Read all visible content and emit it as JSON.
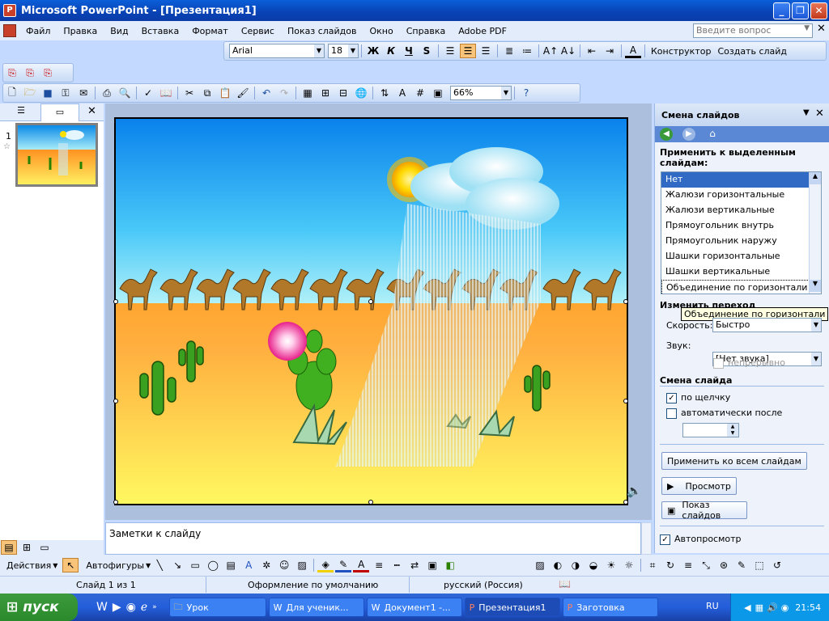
{
  "app": {
    "title": "Microsoft PowerPoint - [Презентация1]"
  },
  "menu": {
    "items": [
      "Файл",
      "Правка",
      "Вид",
      "Вставка",
      "Формат",
      "Сервис",
      "Показ слайдов",
      "Окно",
      "Справка",
      "Adobe PDF"
    ],
    "help_placeholder": "Введите вопрос"
  },
  "formatting": {
    "font": "Arial",
    "size": "18",
    "bold": "Ж",
    "italic": "К",
    "underline": "Ч",
    "shadow": "S",
    "designer": "Конструктор",
    "new_slide": "Создать слайд"
  },
  "standard": {
    "zoom": "66%"
  },
  "slides_panel": {
    "slide_number": "1"
  },
  "notes": {
    "placeholder": "Заметки к слайду"
  },
  "taskpane": {
    "title": "Смена слайдов",
    "apply_label": "Применить к выделенным слайдам:",
    "transitions": [
      "Нет",
      "Жалюзи горизонтальные",
      "Жалюзи вертикальные",
      "Прямоугольник внутрь",
      "Прямоугольник наружу",
      "Шашки горизонтальные",
      "Шашки вертикальные",
      "Объединение по горизонтали"
    ],
    "selected_index": 0,
    "modify_label": "Изменить переход",
    "tooltip": "Объединение по горизонтали",
    "speed_label": "Скорость:",
    "speed_value": "Быстро",
    "sound_label": "Звук:",
    "sound_value": "[Нет звука]",
    "loop_label": "непрерывно",
    "advance_title": "Смена слайда",
    "on_click_label": "по щелчку",
    "auto_label": "автоматически после",
    "apply_all": "Применить ко всем слайдам",
    "preview": "Просмотр",
    "slideshow": "Показ слайдов",
    "autopreview": "Автопросмотр"
  },
  "drawing": {
    "actions": "Действия",
    "autoshapes": "Автофигуры"
  },
  "status": {
    "slide": "Слайд 1 из 1",
    "design": "Оформление по умолчанию",
    "language": "русский (Россия)"
  },
  "taskbar": {
    "start": "пуск",
    "tasks": [
      "Урок",
      "Для ученик...",
      "Документ1 -...",
      "Презентация1",
      "Заготовка"
    ],
    "active_task": 3,
    "lang": "RU",
    "clock": "21:54"
  },
  "colors": {
    "accent": "#316ac5",
    "title_bar": "#0a5fd9",
    "taskbar": "#245edb"
  }
}
